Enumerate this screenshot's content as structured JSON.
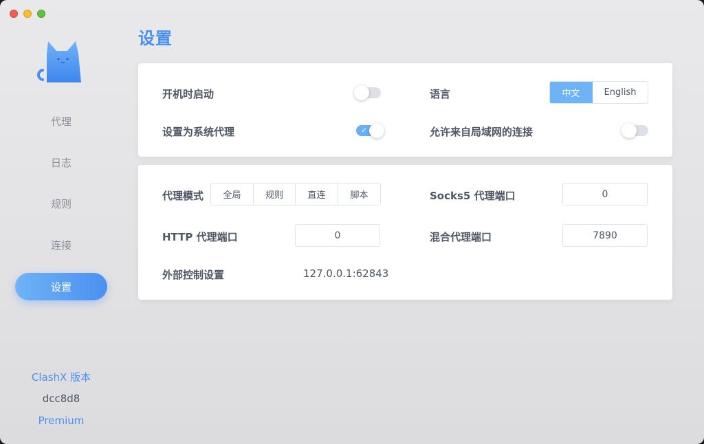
{
  "sidebar": {
    "nav": [
      {
        "label": "代理"
      },
      {
        "label": "日志"
      },
      {
        "label": "规则"
      },
      {
        "label": "连接"
      },
      {
        "label": "设置",
        "active": true
      }
    ],
    "footer": {
      "version_label": "ClashX 版本",
      "version_value": "dcc8d8",
      "edition": "Premium"
    }
  },
  "main": {
    "title": "设置",
    "general": {
      "launch_at_login": {
        "label": "开机时启动",
        "on": false
      },
      "system_proxy": {
        "label": "设置为系统代理",
        "on": true
      },
      "language": {
        "label": "语言",
        "options": [
          "中文",
          "English"
        ],
        "selected": "中文"
      },
      "allow_lan": {
        "label": "允许来自局域网的连接",
        "on": false
      }
    },
    "proxy": {
      "mode": {
        "label": "代理模式",
        "options": [
          "全局",
          "规则",
          "直连",
          "脚本"
        ]
      },
      "socks5_port": {
        "label": "Socks5 代理端口",
        "value": "0"
      },
      "http_port": {
        "label": "HTTP 代理端口",
        "value": "0"
      },
      "mixed_port": {
        "label": "混合代理端口",
        "value": "7890"
      },
      "external_controller": {
        "label": "外部控制设置",
        "value": "127.0.0.1:62843"
      }
    }
  },
  "colors": {
    "accent": "#4a90f0",
    "accent_light": "#6fb3f7",
    "text": "#4f5666",
    "muted": "#8a8f99"
  }
}
